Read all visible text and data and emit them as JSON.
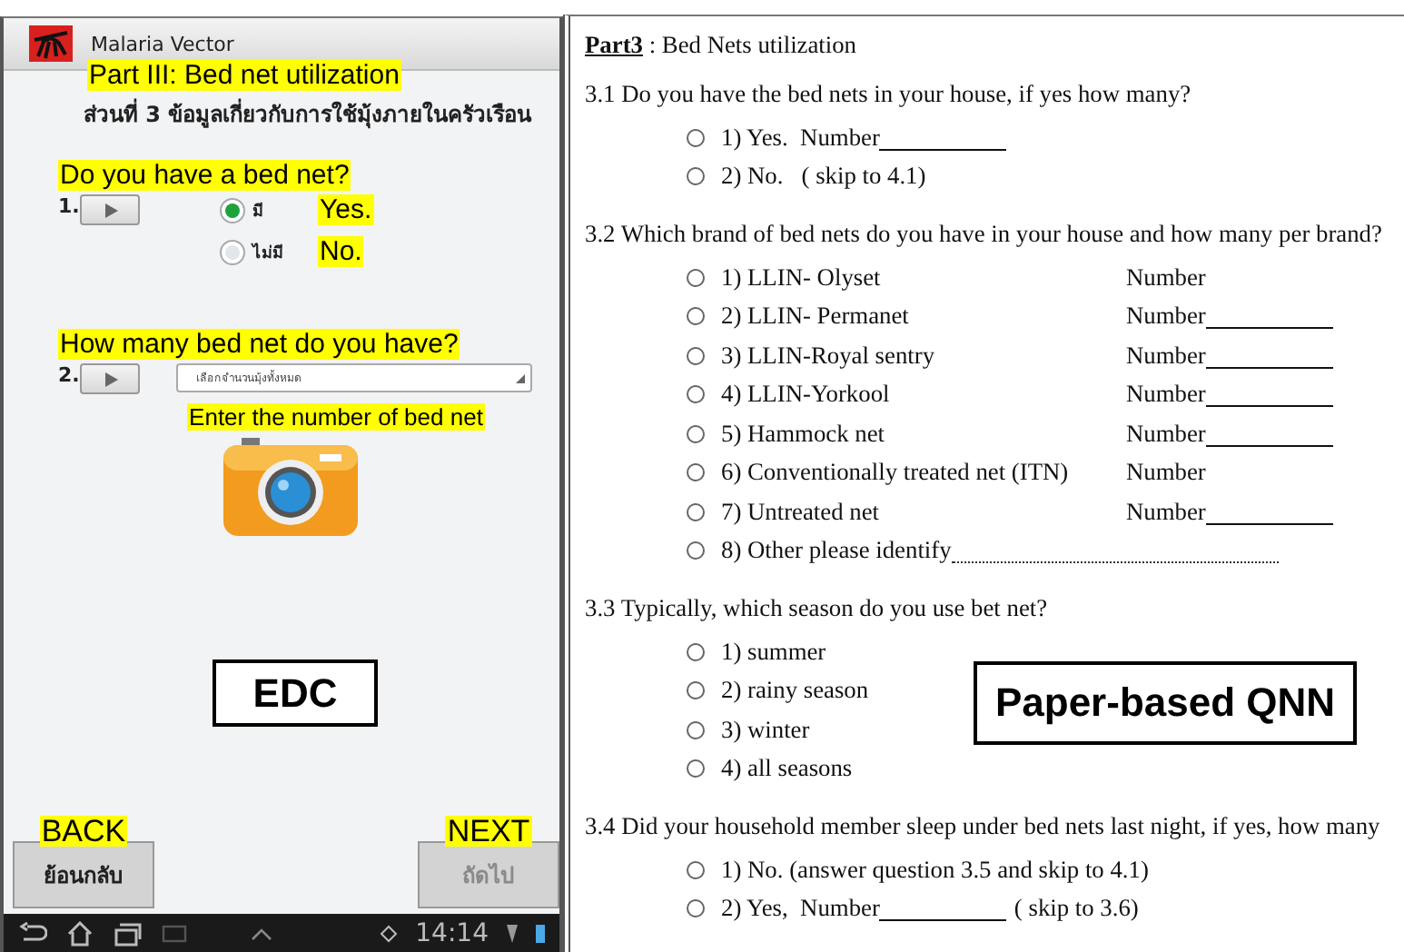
{
  "edc": {
    "title": "Malaria Vector",
    "part_heading": "Part III: Bed net utilization",
    "part_heading_thai": "ส่วนที่ 3 ข้อมูลเกี่ยวกับการใช้มุ้งภายในครัวเรือน",
    "questions": [
      {
        "kind": "radio",
        "number": "1.",
        "annotation": "Do you have a bed net?",
        "options": [
          {
            "label": "มี",
            "annotation": "Yes.",
            "selected": true
          },
          {
            "label": "ไม่มี",
            "annotation": "No.",
            "selected": false
          }
        ]
      },
      {
        "kind": "dropdown",
        "number": "2.",
        "annotation": "How many bed net do you have?",
        "placeholder": "เลือกจำนวนมุ้งทั้งหมด",
        "hint_annotation": "Enter the number of bed net"
      }
    ],
    "caption": "EDC",
    "back": {
      "annotation": "BACK",
      "label": "ย้อนกลับ",
      "disabled": false
    },
    "next": {
      "annotation": "NEXT",
      "label": "ถัดไป",
      "disabled": true
    },
    "status_bar": {
      "time": "14:14"
    }
  },
  "paper": {
    "part": "Part3",
    "heading": " : Bed Nets utilization",
    "caption": "Paper-based QNN",
    "questions": [
      {
        "text": "3.1 Do you have the bed nets in your house, if yes how many?",
        "options": [
          {
            "text": "1) Yes.  Number",
            "blank": true
          },
          {
            "text": "2) No.   ( skip to 4.1)",
            "blank": false
          }
        ]
      },
      {
        "text": "3.2 Which brand of bed nets do you have in your house and how many per brand?",
        "options": [
          {
            "text": "1) LLIN- Olyset",
            "column_label": "Number",
            "blank": false
          },
          {
            "text": "2) LLIN- Permanet",
            "column_label": "Number",
            "blank": true
          },
          {
            "text": "3) LLIN-Royal sentry",
            "column_label": "Number",
            "blank": true
          },
          {
            "text": "4) LLIN-Yorkool",
            "column_label": "Number",
            "blank": true
          },
          {
            "text": "5) Hammock net",
            "column_label": "Number",
            "blank": true
          },
          {
            "text": "6) Conventionally treated net (ITN)",
            "column_label": "Number",
            "blank": false
          },
          {
            "text": "7) Untreated net",
            "column_label": "Number",
            "blank": true
          },
          {
            "text": "8) Other please identify",
            "blank": false,
            "dotted": true
          }
        ]
      },
      {
        "text": "3.3 Typically, which season do you use bet net?",
        "options": [
          {
            "text": "1) summer",
            "blank": false
          },
          {
            "text": "2) rainy season",
            "blank": false
          },
          {
            "text": "3) winter",
            "blank": false
          },
          {
            "text": "4) all seasons",
            "blank": false
          }
        ]
      },
      {
        "text": "3.4 Did your household member sleep under bed nets last night, if yes, how many",
        "options": [
          {
            "text": "1) No. (answer question 3.5 and skip to 4.1)",
            "blank": false
          },
          {
            "text": "2) Yes,  Number",
            "blank": true,
            "suffix": "( skip to 3.6)"
          }
        ]
      }
    ]
  }
}
